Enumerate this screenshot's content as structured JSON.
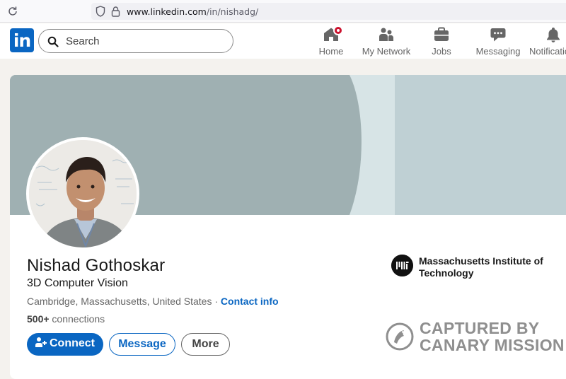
{
  "browser": {
    "url_host": "www.linkedin.com",
    "url_path": "/in/nishadg/"
  },
  "nav": {
    "logo_text": "in",
    "search_placeholder": "Search",
    "items": [
      {
        "label": "Home",
        "icon": "home-icon"
      },
      {
        "label": "My Network",
        "icon": "network-icon"
      },
      {
        "label": "Jobs",
        "icon": "jobs-icon"
      },
      {
        "label": "Messaging",
        "icon": "messaging-icon"
      },
      {
        "label": "Notifications",
        "icon": "bell-icon"
      }
    ]
  },
  "profile": {
    "name": "Nishad Gothoskar",
    "headline": "3D Computer Vision",
    "location": "Cambridge, Massachusetts, United States",
    "location_separator": " · ",
    "contact_info": "Contact info",
    "connections_count": "500+",
    "connections_label": " connections",
    "buttons": {
      "connect": "Connect",
      "message": "Message",
      "more": "More"
    },
    "organization": "Massachusetts Institute of Technology"
  },
  "watermark": {
    "line1": "CAPTURED BY",
    "line2": "CANARY MISSION"
  },
  "colors": {
    "linkedin_blue": "#0a66c2",
    "badge_red": "#cb112d",
    "banner_dark": "#9fb0b2",
    "banner_light": "#bfd0d4"
  }
}
